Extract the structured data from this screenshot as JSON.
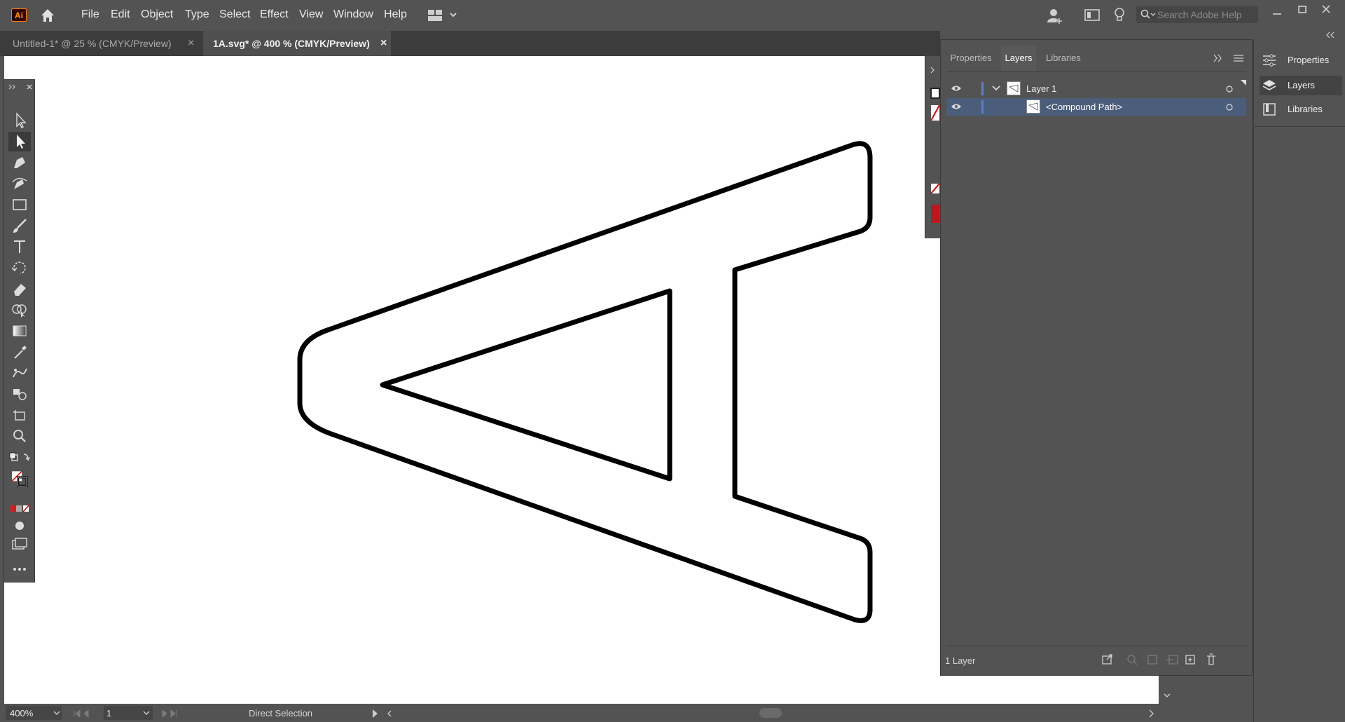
{
  "app": {
    "logo_text": "Ai"
  },
  "menu": {
    "items": [
      "File",
      "Edit",
      "Object",
      "Type",
      "Select",
      "Effect",
      "View",
      "Window",
      "Help"
    ]
  },
  "search": {
    "placeholder": "Search Adobe Help"
  },
  "tabs": [
    {
      "label": "Untitled-1* @ 25 % (CMYK/Preview)",
      "close": "×"
    },
    {
      "label": "1A.svg* @ 400 % (CMYK/Preview)",
      "close": "×"
    }
  ],
  "layers_panel": {
    "tabs": [
      "Properties",
      "Layers",
      "Libraries"
    ],
    "active_tab": "Layers",
    "rows": [
      {
        "name": "Layer 1"
      },
      {
        "name": "<Compound Path>"
      }
    ],
    "footer": "1 Layer"
  },
  "dock": {
    "items": [
      "Properties",
      "Layers",
      "Libraries"
    ]
  },
  "status": {
    "zoom": "400%",
    "artboard": "1",
    "tool": "Direct Selection"
  },
  "colors": {
    "accent": "#5b7fc8",
    "selected_row": "#4a5d7a",
    "canvas": "#ffffff",
    "chrome": "#535353"
  }
}
